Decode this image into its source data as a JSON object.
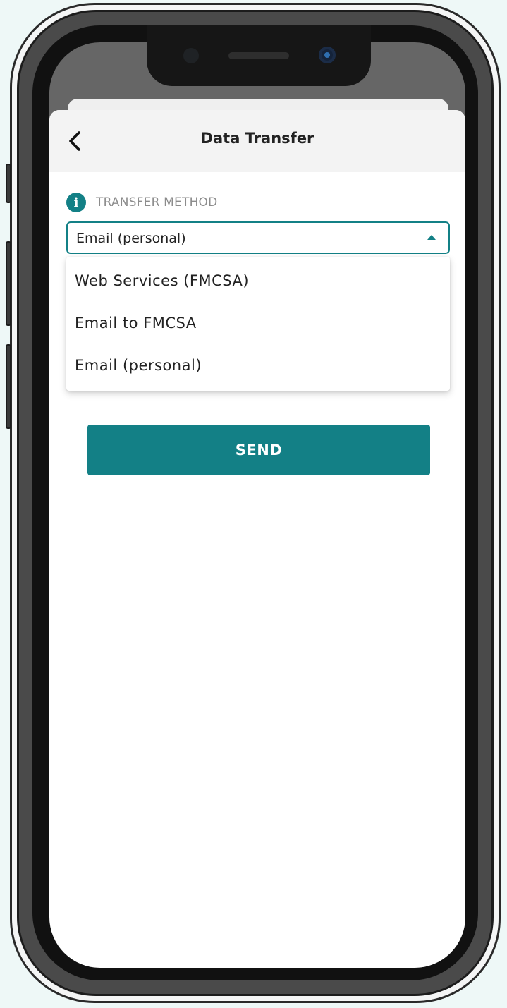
{
  "header": {
    "title": "Data Transfer",
    "back_icon": "chevron-left-icon"
  },
  "transfer_method": {
    "info_icon": "info-icon",
    "label": "TRANSFER METHOD",
    "selected_value": "Email (personal)",
    "options": [
      "Web Services (FMCSA)",
      "Email to FMCSA",
      "Email (personal)"
    ]
  },
  "actions": {
    "send_label": "SEND"
  },
  "colors": {
    "accent": "#138086",
    "header_bg": "#f3f3f3",
    "label_gray": "#8c8c8c"
  }
}
